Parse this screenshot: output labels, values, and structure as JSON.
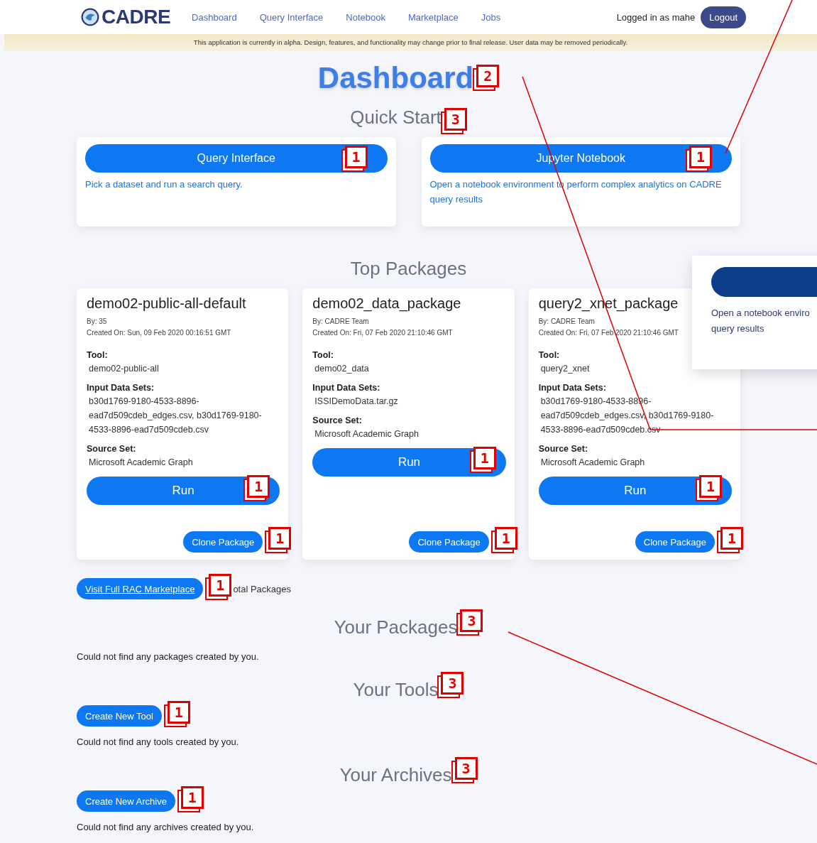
{
  "nav": {
    "logo": "CADRE",
    "links": [
      {
        "label": "Dashboard"
      },
      {
        "label": "Query Interface"
      },
      {
        "label": "Notebook"
      },
      {
        "label": "Marketplace"
      },
      {
        "label": "Jobs"
      }
    ],
    "login_text": "Logged in as mahe",
    "logout": "Logout"
  },
  "banner": "This application is currently in alpha. Design, features, and functionality may change prior to final release. User data may be removed periodically.",
  "title": {
    "text": "Dashboard",
    "marker": "2"
  },
  "quick_start": {
    "heading": {
      "text": "Quick Start",
      "marker": "3"
    },
    "cards": [
      {
        "button": "Query Interface",
        "marker": "1",
        "description": "Pick a dataset and run a search query."
      },
      {
        "button": "Jupyter Notebook",
        "marker": "1",
        "description": "Open a notebook environment to perform complex analytics on CADRE query results"
      }
    ]
  },
  "top_packages": {
    "heading": {
      "text": "Top Packages"
    },
    "packages": [
      {
        "name": "demo02-public-all-default",
        "by": "By: 35",
        "created": "Created On: Sun, 09 Feb 2020 00:16:51 GMT",
        "tool_label": "Tool:",
        "tool": "demo02-public-all",
        "inputs_label": "Input Data Sets:",
        "inputs": "b30d1769-9180-4533-8896-ead7d509cdeb_edges.csv, b30d1769-9180-4533-8896-ead7d509cdeb.csv",
        "source_label": "Source Set:",
        "source": "Microsoft Academic Graph",
        "run": {
          "label": "Run",
          "marker": "1"
        },
        "clone": {
          "label": "Clone Package",
          "marker": "1"
        }
      },
      {
        "name": "demo02_data_package",
        "by": "By: CADRE Team",
        "created": "Created On: Fri, 07 Feb 2020 21:10:46 GMT",
        "tool_label": "Tool:",
        "tool": "demo02_data",
        "inputs_label": "Input Data Sets:",
        "inputs": "ISSIDemoData.tar.gz",
        "source_label": "Source Set:",
        "source": "Microsoft Academic Graph",
        "run": {
          "label": "Run",
          "marker": "1"
        },
        "clone": {
          "label": "Clone Package",
          "marker": "1"
        }
      },
      {
        "name": "query2_xnet_package",
        "by": "By: CADRE Team",
        "created": "Created On: Fri, 07 Feb 2020 21:10:46 GMT",
        "tool_label": "Tool:",
        "tool": "query2_xnet",
        "inputs_label": "Input Data Sets:",
        "inputs": "b30d1769-9180-4533-8896-ead7d509cdeb_edges.csv, b30d1769-9180-4533-8896-ead7d509cdeb.csv",
        "source_label": "Source Set:",
        "source": "Microsoft Academic Graph",
        "run": {
          "label": "Run",
          "marker": "1"
        },
        "clone": {
          "label": "Clone Package",
          "marker": "1"
        }
      }
    ],
    "marketplace_button": {
      "label": "Visit Full RAC Marketplace",
      "marker": "1"
    },
    "total_text": "otal Packages"
  },
  "sections": [
    {
      "heading": {
        "text": "Your Packages",
        "marker": "3"
      },
      "empty": "Could not find any packages created by you."
    },
    {
      "heading": {
        "text": "Your Tools",
        "marker": "3"
      },
      "button": {
        "label": "Create New Tool",
        "marker": "1"
      },
      "empty": "Could not find any tools created by you."
    },
    {
      "heading": {
        "text": "Your Archives",
        "marker": "3"
      },
      "button": {
        "label": "Create New Archive",
        "marker": "1"
      },
      "empty": "Could not find any archives created by you."
    }
  ],
  "callout": {
    "lines": [
      "Open a notebook enviro",
      "query results"
    ]
  }
}
